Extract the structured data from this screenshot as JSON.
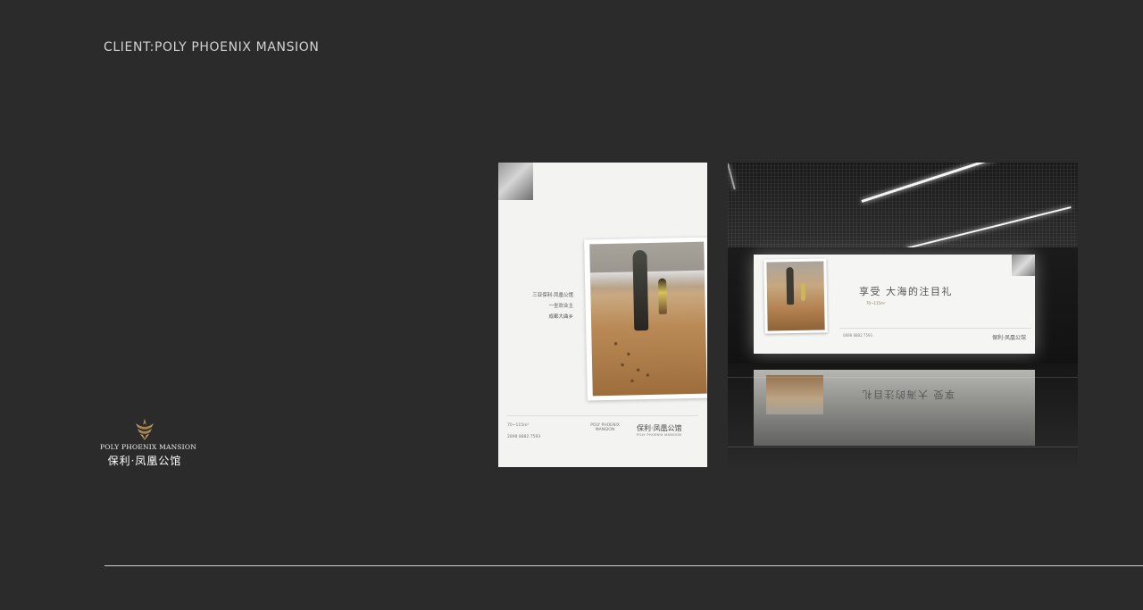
{
  "header": {
    "client_title": "CLIENT:POLY PHOENIX MANSION"
  },
  "brand": {
    "emblem_icon": "phoenix-emblem-icon",
    "name_en": "POLY PHOENIX MANSION",
    "name_cn": "保利·凤凰公馆",
    "gold": "#b08a52"
  },
  "poster": {
    "copy_lines": [
      "三亚保利·凤凰公馆",
      "一坐欢业主",
      "成都大曲乡"
    ],
    "area_text": "70~115m²",
    "phone": "2898 8882 7593",
    "brand_cn": "保利·凤凰公馆",
    "brand_en": "POLY PHOENIX MANSION"
  },
  "billboard": {
    "headline": "享受  大海的注目礼",
    "sub": "70~115m²",
    "phone": "0898 8882 7593",
    "brand_cn": "保利·凤凰公馆"
  },
  "colors": {
    "background": "#2b2b2b",
    "rule": "#cfcfcf"
  }
}
